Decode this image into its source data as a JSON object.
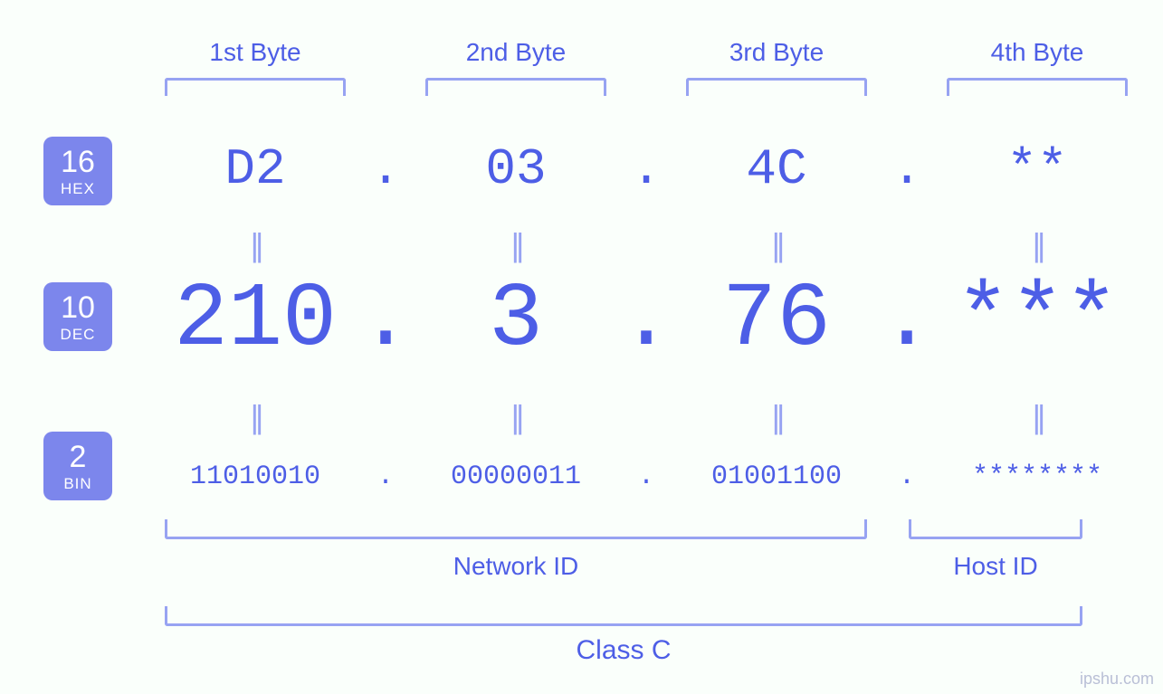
{
  "radix": {
    "hex": {
      "num": "16",
      "name": "HEX"
    },
    "dec": {
      "num": "10",
      "name": "DEC"
    },
    "bin": {
      "num": "2",
      "name": "BIN"
    }
  },
  "byte_labels": [
    "1st Byte",
    "2nd Byte",
    "3rd Byte",
    "4th Byte"
  ],
  "hex": [
    "D2",
    "03",
    "4C",
    "**"
  ],
  "dec": [
    "210",
    "3",
    "76",
    "***"
  ],
  "bin": [
    "11010010",
    "00000011",
    "01001100",
    "********"
  ],
  "separator": ".",
  "equal_symbol": "||",
  "sections": {
    "network_id": "Network ID",
    "host_id": "Host ID",
    "class": "Class C"
  },
  "watermark": "ipshu.com"
}
